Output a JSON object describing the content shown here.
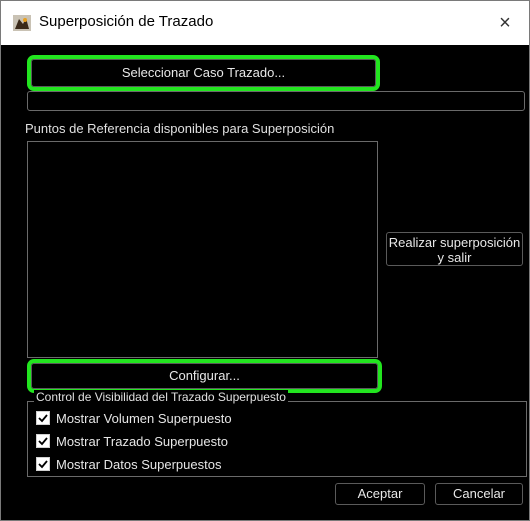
{
  "window": {
    "title": "Superposición de Trazado",
    "close_glyph": "×"
  },
  "buttons": {
    "select_case": "Seleccionar Caso Trazado...",
    "overlay_exit": "Realizar superposición y salir",
    "configure": "Configurar...",
    "accept": "Aceptar",
    "cancel": "Cancelar"
  },
  "labels": {
    "reference_points": "Puntos de Referencia disponibles para Superposición",
    "visibility_group": "Control de Visibilidad del Trazado Superpuesto"
  },
  "checkboxes": [
    {
      "label": "Mostrar Volumen Superpuesto",
      "checked": true
    },
    {
      "label": "Mostrar Trazado Superpuesto",
      "checked": true
    },
    {
      "label": "Mostrar Datos Superpuestos",
      "checked": true
    }
  ],
  "colors": {
    "highlight": "#22e51f",
    "background": "#000000"
  }
}
